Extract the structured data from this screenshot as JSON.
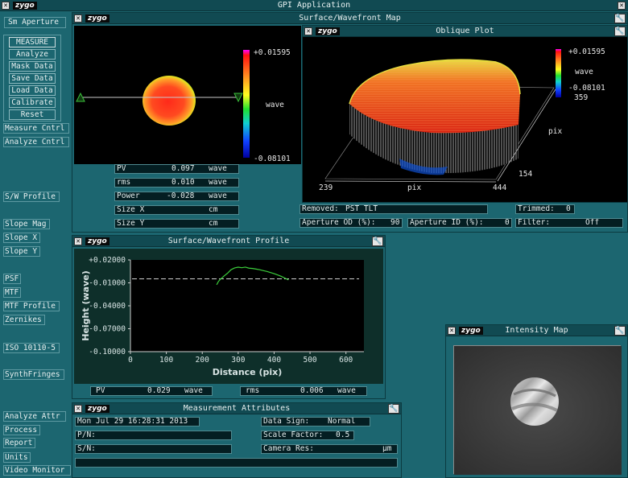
{
  "app": {
    "title": "GPI Application",
    "logo": "zygo"
  },
  "sidebar": {
    "top_label": "Sm Aperture",
    "group_buttons": [
      "MEASURE",
      "Analyze",
      "Mask Data",
      "Save Data",
      "Load Data",
      "Calibrate",
      "Reset"
    ],
    "items": [
      {
        "id": "measure-cntrl",
        "label": "Measure Cntrl"
      },
      {
        "id": "analyze-cntrl",
        "label": "Analyze Cntrl"
      },
      {
        "id": "sw-profile",
        "label": "S/W Profile"
      },
      {
        "id": "slope-mag",
        "label": "Slope Mag"
      },
      {
        "id": "slope-x",
        "label": "Slope X"
      },
      {
        "id": "slope-y",
        "label": "Slope Y"
      },
      {
        "id": "psf",
        "label": "PSF"
      },
      {
        "id": "mtf",
        "label": "MTF"
      },
      {
        "id": "mtf-profile",
        "label": "MTF Profile"
      },
      {
        "id": "zernikes",
        "label": "Zernikes"
      },
      {
        "id": "iso",
        "label": "ISO 10110-5"
      },
      {
        "id": "synthfringes",
        "label": "SynthFringes"
      },
      {
        "id": "analyze-attr",
        "label": "Analyze Attr"
      },
      {
        "id": "process",
        "label": "Process"
      },
      {
        "id": "report",
        "label": "Report"
      },
      {
        "id": "units",
        "label": "Units"
      },
      {
        "id": "video-monitor",
        "label": "Video Monitor"
      }
    ]
  },
  "surface_map": {
    "title": "Surface/Wavefront Map",
    "scale_max": "+0.01595",
    "scale_unit": "wave",
    "scale_min": "-0.08101",
    "stats": [
      {
        "label": "PV",
        "value": "0.097",
        "unit": "wave"
      },
      {
        "label": "rms",
        "value": "0.010",
        "unit": "wave"
      },
      {
        "label": "Power",
        "value": "-0.028",
        "unit": "wave"
      },
      {
        "label": "Size X",
        "value": "",
        "unit": "cm"
      },
      {
        "label": "Size Y",
        "value": "",
        "unit": "cm"
      }
    ]
  },
  "oblique": {
    "title": "Oblique Plot",
    "scale_max": "+0.01595",
    "scale_unit": "wave",
    "scale_min": "-0.08101",
    "x_start": "239",
    "x_label": "pix",
    "x_end": "444",
    "y_top": "359",
    "y_label": "pix",
    "y_bottom": "154"
  },
  "status": {
    "removed_label": "Removed:",
    "removed_value": "PST TLT",
    "trimmed_label": "Trimmed:",
    "trimmed_value": "0",
    "aperture_od_label": "Aperture OD (%):",
    "aperture_od_value": "90",
    "aperture_id_label": "Aperture ID (%):",
    "aperture_id_value": "0",
    "filter_label": "Filter:",
    "filter_value": "Off"
  },
  "profile": {
    "title": "Surface/Wavefront Profile",
    "pv_label": "PV",
    "pv_value": "0.029",
    "pv_unit": "wave",
    "rms_label": "rms",
    "rms_value": "0.006",
    "rms_unit": "wave"
  },
  "chart_data": {
    "type": "line",
    "xlabel": "Distance (pix)",
    "ylabel": "Height (wave)",
    "xlim": [
      0,
      650
    ],
    "ylim": [
      -0.1,
      0.02
    ],
    "x_ticks": [
      "0",
      "100",
      "200",
      "300",
      "400",
      "500",
      "600"
    ],
    "y_ticks": [
      "+0.02000",
      "-0.01000",
      "-0.04000",
      "-0.07000",
      "-0.10000"
    ],
    "reference_line_y": -0.0048,
    "series": [
      {
        "color": "#3ccf3c",
        "x": [
          240,
          245,
          250,
          255,
          260,
          270,
          280,
          290,
          300,
          310,
          320,
          330,
          340,
          350,
          360,
          370,
          380,
          390,
          400,
          410,
          420,
          430,
          440
        ],
        "y": [
          -0.0125,
          -0.0082,
          -0.0055,
          -0.0035,
          -0.0012,
          0.0025,
          0.0072,
          0.0095,
          0.0105,
          0.0098,
          0.0106,
          0.0092,
          0.0088,
          0.008,
          0.0072,
          0.006,
          0.0049,
          0.0035,
          0.002,
          0.0003,
          -0.0015,
          -0.0038,
          -0.0062
        ]
      }
    ]
  },
  "intensity": {
    "title": "Intensity Map"
  },
  "attributes": {
    "title": "Measurement Attributes",
    "date": "Mon Jul 29 16:28:31 2013",
    "pn_label": "P/N:",
    "sn_label": "S/N:",
    "data_sign_label": "Data Sign:",
    "data_sign_value": "Normal",
    "scale_factor_label": "Scale Factor:",
    "scale_factor_value": "0.5",
    "camera_res_label": "Camera Res:",
    "camera_res_unit": "µm"
  }
}
